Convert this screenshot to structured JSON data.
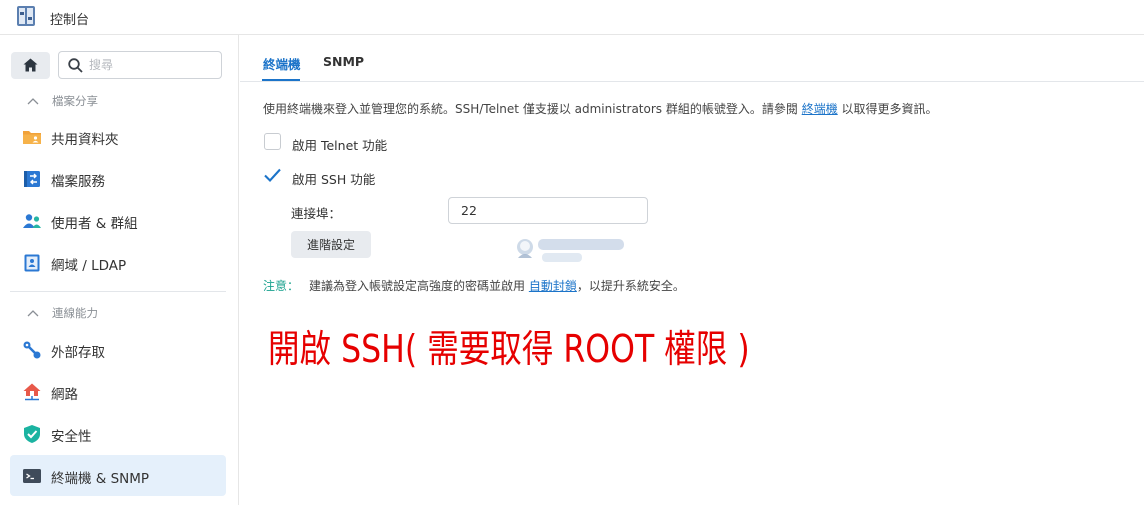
{
  "window": {
    "title": "控制台",
    "icon": "control-panel-icon"
  },
  "sidebar": {
    "home_icon": "home-icon",
    "search": {
      "placeholder": "搜尋",
      "value": ""
    },
    "sections": [
      {
        "label": "檔案分享",
        "collapsed": false
      },
      {
        "label": "連線能力",
        "collapsed": false
      }
    ],
    "items": [
      {
        "label": "共用資料夾",
        "icon": "shared-folder-icon"
      },
      {
        "label": "檔案服務",
        "icon": "file-services-icon"
      },
      {
        "label": "使用者 & 群組",
        "icon": "users-groups-icon"
      },
      {
        "label": "網域 / LDAP",
        "icon": "domain-ldap-icon"
      },
      {
        "label": "外部存取",
        "icon": "external-access-icon"
      },
      {
        "label": "網路",
        "icon": "network-icon"
      },
      {
        "label": "安全性",
        "icon": "security-shield-icon"
      },
      {
        "label": "終端機 & SNMP",
        "icon": "terminal-icon",
        "active": true
      }
    ]
  },
  "main": {
    "tabs": [
      {
        "label": "終端機",
        "active": true
      },
      {
        "label": "SNMP",
        "active": false
      }
    ],
    "description": {
      "before": "使用終端機來登入並管理您的系統。SSH/Telnet 僅支援以 administrators 群組的帳號登入。請參閱 ",
      "link": "終端機",
      "after": " 以取得更多資訊。"
    },
    "telnet": {
      "label": "啟用 Telnet 功能",
      "checked": false
    },
    "ssh": {
      "label": "啟用 SSH 功能",
      "checked": true
    },
    "port": {
      "label": "連接埠：",
      "value": "22"
    },
    "advanced_button": "進階設定",
    "note": {
      "label": "注意：",
      "before": "建議為登入帳號設定高強度的密碼並啟用 ",
      "link": "自動封鎖",
      "after": "，以提升系統安全。"
    }
  },
  "annotation": {
    "text": "開啟 SSH( 需要取得 ROOT 權限 )",
    "color": "#e60000"
  },
  "colors": {
    "accent": "#1c74c9",
    "active_bg": "#e5f0fb",
    "note": "#1ba28f"
  }
}
